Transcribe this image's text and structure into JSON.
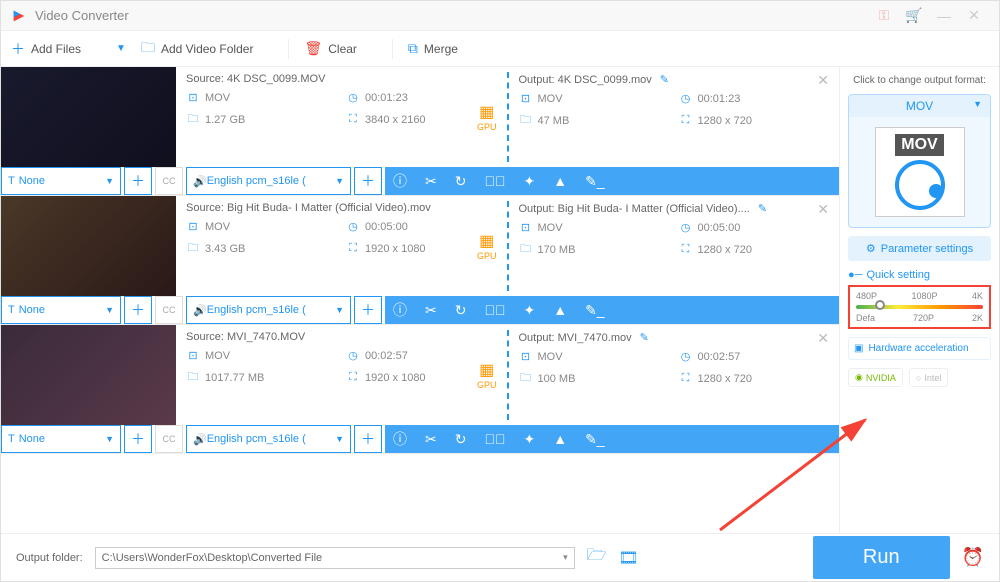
{
  "titlebar": {
    "title": "Video Converter"
  },
  "toolbar": {
    "add_files": "Add Files",
    "add_folder": "Add Video Folder",
    "clear": "Clear",
    "merge": "Merge"
  },
  "items": [
    {
      "source_label": "Source: 4K DSC_0099.MOV",
      "src_format": "MOV",
      "src_duration": "00:01:23",
      "src_size": "1.27 GB",
      "src_res": "3840 x 2160",
      "output_label": "Output: 4K DSC_0099.mov",
      "out_format": "MOV",
      "out_duration": "00:01:23",
      "out_size": "47 MB",
      "out_res": "1280 x 720",
      "subtitle": "None",
      "audio": "English pcm_s16le ("
    },
    {
      "source_label": "Source: Big Hit Buda- I Matter (Official Video).mov",
      "src_format": "MOV",
      "src_duration": "00:05:00",
      "src_size": "3.43 GB",
      "src_res": "1920 x 1080",
      "output_label": "Output: Big Hit Buda- I Matter (Official Video)....",
      "out_format": "MOV",
      "out_duration": "00:05:00",
      "out_size": "170 MB",
      "out_res": "1280 x 720",
      "subtitle": "None",
      "audio": "English pcm_s16le ("
    },
    {
      "source_label": "Source: MVI_7470.MOV",
      "src_format": "MOV",
      "src_duration": "00:02:57",
      "src_size": "1017.77 MB",
      "src_res": "1920 x 1080",
      "output_label": "Output: MVI_7470.mov",
      "out_format": "MOV",
      "out_duration": "00:02:57",
      "out_size": "100 MB",
      "out_res": "1280 x 720",
      "subtitle": "None",
      "audio": "English pcm_s16le ("
    }
  ],
  "sidebar": {
    "change_format": "Click to change output format:",
    "format": "MOV",
    "mov_label": "MOV",
    "param_settings": "Parameter settings",
    "quick_setting": "Quick setting",
    "resolutions": {
      "p1": "480P",
      "p2": "1080P",
      "p3": "4K",
      "p4": "Defa",
      "p5": "720P",
      "p6": "2K"
    },
    "hw_accel": "Hardware acceleration",
    "nvidia": "NVIDIA",
    "intel": "Intel"
  },
  "footer": {
    "label": "Output folder:",
    "path": "C:\\Users\\WonderFox\\Desktop\\Converted File",
    "run": "Run"
  },
  "gpu": "GPU"
}
